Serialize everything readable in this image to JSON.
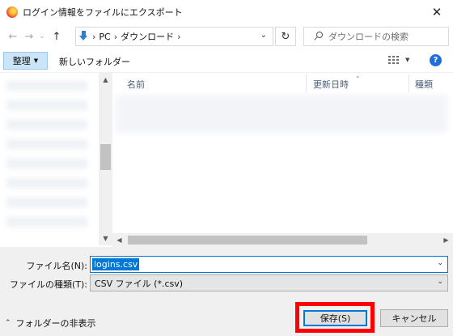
{
  "window": {
    "title": "ログイン情報をファイルにエクスポート",
    "close_glyph": "✕"
  },
  "nav": {
    "back_glyph": "←",
    "forward_glyph": "→",
    "recent_glyph": "⌄",
    "up_glyph": "↑",
    "breadcrumb": [
      "PC",
      "ダウンロード"
    ],
    "sep_glyph": "›",
    "dropdown_glyph": "⌄",
    "refresh_glyph": "↻",
    "search_placeholder": "ダウンロードの検索"
  },
  "toolbar": {
    "organize_label": "整理",
    "organize_caret": "▼",
    "new_folder_label": "新しいフォルダー",
    "view_caret": "▼",
    "help_glyph": "?"
  },
  "columns": [
    {
      "label": "名前"
    },
    {
      "label": "更新日時"
    },
    {
      "label": "種類"
    }
  ],
  "sort_glyph": "⌄",
  "scroll": {
    "up": "▲",
    "down": "▼",
    "left": "◀",
    "right": "▶"
  },
  "form": {
    "filename_label": "ファイル名(N):",
    "filename_value": "logins.csv",
    "filetype_label": "ファイルの種類(T):",
    "filetype_value": "CSV ファイル (*.csv)",
    "dropdown_glyph": "⌄"
  },
  "footer": {
    "hide_folders_label": "フォルダーの非表示",
    "chevron_glyph": "⌃",
    "save_label": "保存(S)",
    "cancel_label": "キャンセル"
  },
  "colors": {
    "accent": "#0078d7",
    "highlight": "#ff0000",
    "organize_bg": "#cce4f7"
  }
}
